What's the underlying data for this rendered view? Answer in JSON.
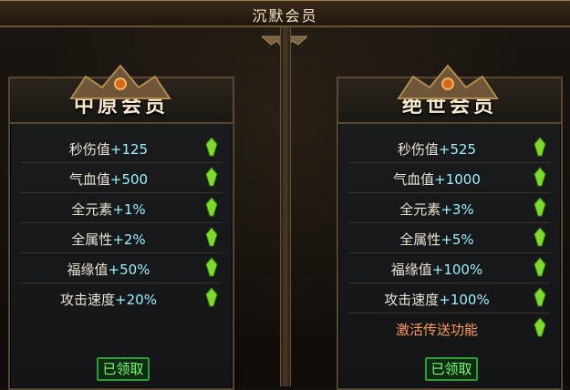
{
  "header": {
    "title": "沉默会员"
  },
  "panels": {
    "left": {
      "title": "中原会员",
      "stats": [
        {
          "name": "秒伤值",
          "value": "+125"
        },
        {
          "name": "气血值",
          "value": "+500"
        },
        {
          "name": "全元素",
          "value": "+1%"
        },
        {
          "name": "全属性",
          "value": "+2%"
        },
        {
          "name": "福缘值",
          "value": "+50%"
        },
        {
          "name": "攻击速度",
          "value": "+20%"
        }
      ],
      "button_label": "已领取"
    },
    "right": {
      "title": "绝世会员",
      "stats": [
        {
          "name": "秒伤值",
          "value": "+525"
        },
        {
          "name": "气血值",
          "value": "+1000"
        },
        {
          "name": "全元素",
          "value": "+3%"
        },
        {
          "name": "全属性",
          "value": "+5%"
        },
        {
          "name": "福缘值",
          "value": "+100%"
        },
        {
          "name": "攻击速度",
          "value": "+100%"
        },
        {
          "name": "激活传送功能",
          "value": ""
        }
      ],
      "button_label": "已领取"
    }
  },
  "colors": {
    "stat_value": "#9af0ff",
    "special_text": "#ff9a55",
    "button_text": "#72ff6f",
    "gem": "#7ddc2b"
  }
}
